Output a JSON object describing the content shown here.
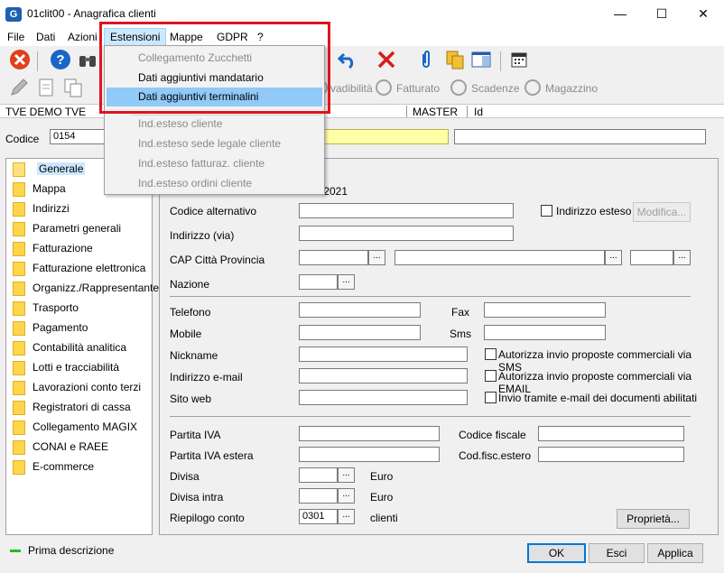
{
  "window": {
    "title": "01clit00 - Anagrafica clienti",
    "app_icon": "G",
    "minimize": "—",
    "maximize": "☐",
    "close": "✕"
  },
  "menubar": [
    "File",
    "Dati",
    "Azioni",
    "Estensioni",
    "Mappe",
    "GDPR",
    "?"
  ],
  "dropdown": {
    "items": [
      {
        "label": "Collegamento Zucchetti",
        "enabled": false
      },
      {
        "label": "Dati aggiuntivi mandatario",
        "enabled": true
      },
      {
        "label": "Dati aggiuntivi terminalini",
        "enabled": true,
        "highlighted": true
      },
      {
        "label": "Ind.esteso cliente",
        "enabled": false
      },
      {
        "label": "Ind.esteso sede legale cliente",
        "enabled": false
      },
      {
        "label": "Ind.esteso fatturaz. cliente",
        "enabled": false
      },
      {
        "label": "Ind.esteso ordini cliente",
        "enabled": false
      }
    ]
  },
  "toolbar2": {
    "evadibilita": "vadibilità",
    "fatturato": "Fatturato",
    "scadenze": "Scadenze",
    "magazzino": "Magazzino"
  },
  "infobar": {
    "company": "TVE DEMO TVE",
    "db": "MASTER",
    "id_label": "Id"
  },
  "codice": {
    "label": "Codice",
    "value": "0154",
    "name_value": "",
    "extra_value": ""
  },
  "tree": [
    "Generale",
    "Mappa",
    "Indirizzi",
    "Parametri generali",
    "Fatturazione",
    "Fatturazione elettronica",
    "Organizz./Rappresentante",
    "Trasporto",
    "Pagamento",
    "Contabilità analitica",
    "Lotti e tracciabilità",
    "Lavorazioni conto terzi",
    "Registratori di cassa",
    "Collegamento MAGIX",
    "CONAI e RAEE",
    "E-commerce"
  ],
  "form": {
    "date_fragment": "/2021",
    "codice_alternativo": "Codice alternativo",
    "indirizzo_esteso": "Indirizzo esteso",
    "modifica": "Modifica...",
    "indirizzo_via": "Indirizzo (via)",
    "cap_citta_provincia": "CAP Città Provincia",
    "nazione": "Nazione",
    "telefono": "Telefono",
    "fax": "Fax",
    "mobile": "Mobile",
    "sms": "Sms",
    "nickname": "Nickname",
    "autorizza_sms": "Autorizza invio proposte commerciali via SMS",
    "indirizzo_email": "Indirizzo e-mail",
    "autorizza_email": "Autorizza invio proposte commerciali via EMAIL",
    "sito_web": "Sito web",
    "invio_email": "Invio tramite e-mail dei documenti abilitati",
    "partita_iva": "Partita IVA",
    "codice_fiscale": "Codice fiscale",
    "partita_iva_estera": "Partita IVA estera",
    "cod_fisc_estero": "Cod.fisc.estero",
    "divisa": "Divisa",
    "divisa_value": "Euro",
    "divisa_intra": "Divisa intra",
    "divisa_intra_value": "Euro",
    "riepilogo_conto": "Riepilogo conto",
    "riepilogo_value": "0301",
    "riepilogo_desc": "clienti",
    "proprieta": "Proprietà...",
    "dots": "..."
  },
  "status": {
    "text": "Prima descrizione",
    "indicator_color": "#22bb22"
  },
  "buttons": {
    "ok": "OK",
    "esci": "Esci",
    "applica": "Applica"
  }
}
